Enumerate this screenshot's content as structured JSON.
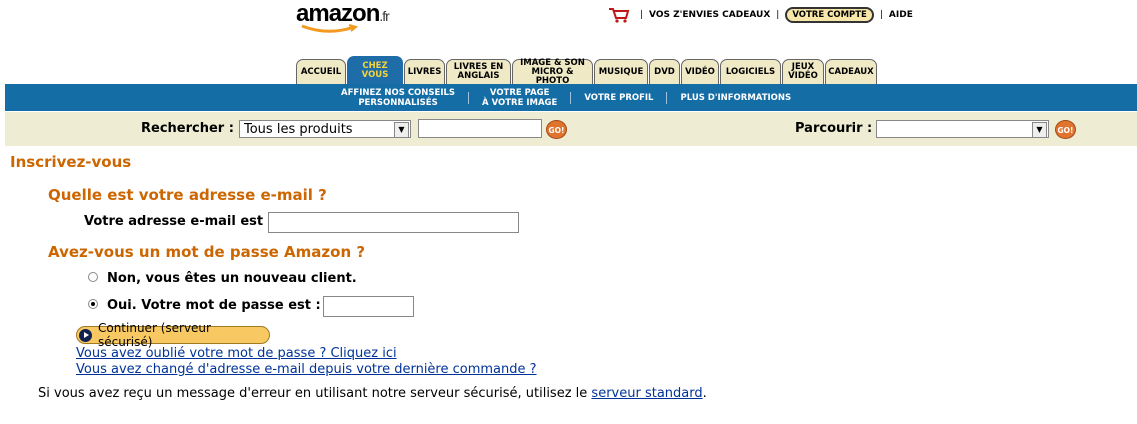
{
  "header": {
    "logo_text": "amazon",
    "logo_tld": ".fr",
    "links": {
      "wishlist": "VOS Z'ENVIES CADEAUX",
      "account": "VOTRE COMPTE",
      "help": "AIDE"
    },
    "cart_icon": "cart-icon"
  },
  "tabs": [
    {
      "label": "ACCUEIL",
      "active": false
    },
    {
      "label": "CHEZ VOUS",
      "active": true
    },
    {
      "label": "LIVRES",
      "active": false
    },
    {
      "label": "LIVRES EN ANGLAIS",
      "active": false
    },
    {
      "label": "IMAGE & SON MICRO & PHOTO",
      "active": false
    },
    {
      "label": "MUSIQUE",
      "active": false
    },
    {
      "label": "DVD",
      "active": false
    },
    {
      "label": "VIDÉO",
      "active": false
    },
    {
      "label": "LOGICIELS",
      "active": false
    },
    {
      "label": "JEUX VIDÉO",
      "active": false
    },
    {
      "label": "CADEAUX",
      "active": false
    }
  ],
  "subnav": {
    "item1_line1": "AFFINEZ NOS CONSEILS",
    "item1_line2": "PERSONNALISÉS",
    "item2_line1": "VOTRE PAGE",
    "item2_line2": "À VOTRE IMAGE",
    "item3": "VOTRE PROFIL",
    "item4": "PLUS D'INFORMATIONS"
  },
  "search": {
    "search_label": "Rechercher :",
    "search_selected": "Tous les produits",
    "search_value": "",
    "browse_label": "Parcourir :",
    "browse_selected": "",
    "go_label": "GO!"
  },
  "signin": {
    "title": "Inscrivez-vous",
    "email_heading": "Quelle est votre adresse e-mail ?",
    "email_label": "Votre adresse e-mail est",
    "email_value": "",
    "password_heading": "Avez-vous un mot de passe Amazon ?",
    "radio_new": "Non, vous êtes un nouveau client.",
    "radio_existing": "Oui. Votre mot de passe est :",
    "password_value": "",
    "continue_label": "Continuer (serveur sécurisé)",
    "forgot_link": "Vous avez oublié votre mot de passe ? Cliquez ici",
    "changed_email_link": "Vous avez changé d'adresse e-mail depuis votre dernière commande ?",
    "error_note": "Si vous avez reçu un message d'erreur en utilisant notre serveur sécurisé, utilisez le",
    "standard_server_link": "serveur standard",
    "note_end": "."
  },
  "colors": {
    "accent_orange": "#cc6600",
    "nav_blue": "#156da6",
    "tab_bg": "#efe9c6",
    "search_bg": "#eeecd2"
  }
}
